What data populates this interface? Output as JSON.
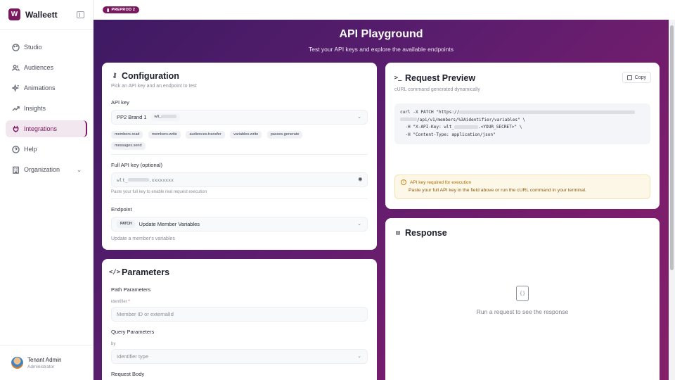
{
  "app": {
    "name": "Walleett",
    "logo_letter": "W",
    "env_badge": "PREPROD 2",
    "brand_color": "#7b1960"
  },
  "sidebar": {
    "items": [
      {
        "label": "Studio",
        "icon": "palette-icon"
      },
      {
        "label": "Audiences",
        "icon": "users-icon"
      },
      {
        "label": "Animations",
        "icon": "sparkles-icon"
      },
      {
        "label": "Insights",
        "icon": "trending-up-icon"
      },
      {
        "label": "Integrations",
        "icon": "plug-icon",
        "active": true
      },
      {
        "label": "Help",
        "icon": "help-circle-icon"
      },
      {
        "label": "Organization",
        "icon": "building-icon",
        "expandable": true
      }
    ],
    "user": {
      "name": "Tenant Admin",
      "role": "Administrator"
    }
  },
  "hero": {
    "title": "API Playground",
    "subtitle": "Test your API keys and explore the available endpoints"
  },
  "configuration": {
    "title": "Configuration",
    "subtitle": "Pick an API key and an endpoint to test",
    "api_key_label": "API key",
    "api_key_selected": "PP2 Brand 1",
    "api_key_prefix": "wlt_",
    "scopes": [
      "members.read",
      "members.write",
      "audiences.transfer",
      "variables.write",
      "passes.generate",
      "messages.send"
    ],
    "full_key_label": "Full API key (optional)",
    "full_key_value_prefix": "wlt_",
    "full_key_value_suffix": ".xxxxxxxx",
    "full_key_hint": "Paste your full key to enable real request execution",
    "endpoint_label": "Endpoint",
    "endpoint_method": "PATCH",
    "endpoint_name": "Update Member Variables",
    "endpoint_description": "Update a member's variables"
  },
  "parameters": {
    "title": "Parameters",
    "path_label": "Path Parameters",
    "identifier_label": "identifier",
    "required_mark": "*",
    "identifier_placeholder": "Member ID or externalId",
    "query_label": "Query Parameters",
    "by_label": "by",
    "by_placeholder": "Identifier type",
    "body_label": "Request Body"
  },
  "request_preview": {
    "title": "Request Preview",
    "subtitle": "cURL command generated dynamically",
    "copy_label": "Copy",
    "code_line1": "curl -X PATCH \"https://",
    "code_line2": "/api/v1/members/%3Aidentifier/variables\" \\",
    "code_line3": "  -H \"X-API-Key: wlt_",
    "code_line3b": ".<YOUR_SECRET>\" \\",
    "code_line4": "  -H \"Content-Type: application/json\"",
    "warning_title": "API key required for execution",
    "warning_text": "Paste your full API key in the field above or run the cURL command in your terminal."
  },
  "response": {
    "title": "Response",
    "empty_text": "Run a request to see the response"
  }
}
